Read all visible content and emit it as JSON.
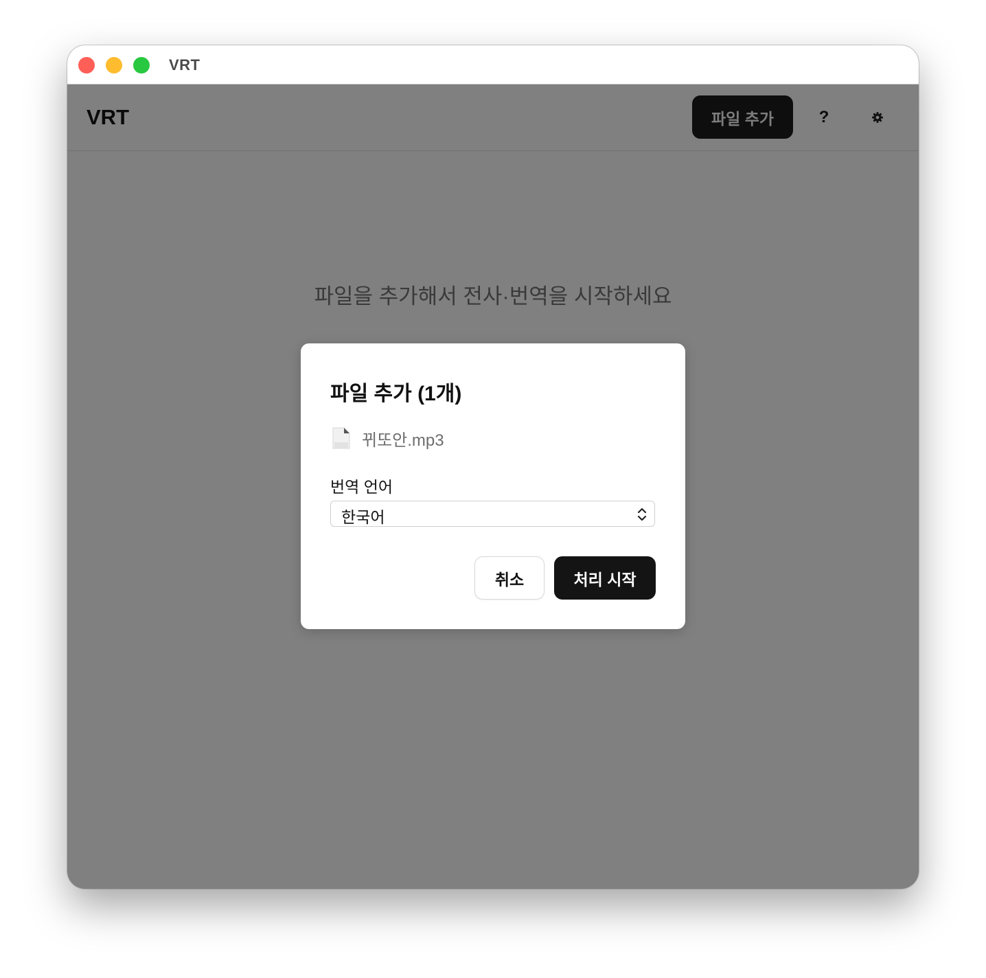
{
  "window": {
    "title": "VRT",
    "controls": [
      {
        "name": "close",
        "color": "#ff5f57"
      },
      {
        "name": "minimize",
        "color": "#febc2e"
      },
      {
        "name": "maximize",
        "color": "#28c840"
      }
    ]
  },
  "header": {
    "logo": "VRT",
    "add_file_label": "파일 추가",
    "help_label": "?",
    "settings_icon": "gear-icon"
  },
  "main": {
    "empty_message": "파일을 추가해서 전사·번역을 시작하세요",
    "overlay_color": "#808080"
  },
  "dialog": {
    "title": "파일 추가 (1개)",
    "files": [
      {
        "name": "뀌또안.mp3",
        "icon": "document-icon"
      }
    ],
    "language_label": "번역 언어",
    "language_selected": "한국어",
    "cancel_label": "취소",
    "start_label": "처리 시작"
  }
}
